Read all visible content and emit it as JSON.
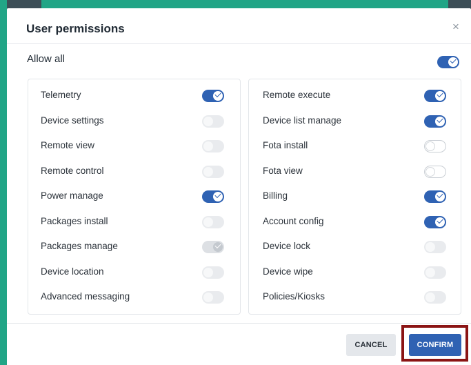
{
  "dialog": {
    "title": "User permissions",
    "close_glyph": "×",
    "allow_all": {
      "label": "Allow all",
      "state": "on"
    }
  },
  "permissions": {
    "left": [
      {
        "label": "Telemetry",
        "state": "on"
      },
      {
        "label": "Device settings",
        "state": "off"
      },
      {
        "label": "Remote view",
        "state": "off"
      },
      {
        "label": "Remote control",
        "state": "off"
      },
      {
        "label": "Power manage",
        "state": "on"
      },
      {
        "label": "Packages install",
        "state": "off"
      },
      {
        "label": "Packages manage",
        "state": "disabled-on"
      },
      {
        "label": "Device location",
        "state": "off"
      },
      {
        "label": "Advanced messaging",
        "state": "off"
      }
    ],
    "right": [
      {
        "label": "Remote execute",
        "state": "on"
      },
      {
        "label": "Device list manage",
        "state": "on"
      },
      {
        "label": "Fota install",
        "state": "outline"
      },
      {
        "label": "Fota view",
        "state": "outline"
      },
      {
        "label": "Billing",
        "state": "on"
      },
      {
        "label": "Account config",
        "state": "on"
      },
      {
        "label": "Device lock",
        "state": "off"
      },
      {
        "label": "Device wipe",
        "state": "off"
      },
      {
        "label": "Policies/Kiosks",
        "state": "off"
      }
    ]
  },
  "footer": {
    "cancel_label": "CANCEL",
    "confirm_label": "CONFIRM"
  },
  "colors": {
    "accent": "#2f62b3",
    "background": "#21a586",
    "highlight": "#8b1414"
  },
  "icons": {
    "close": "close-icon",
    "toggle_check": "check-icon"
  }
}
